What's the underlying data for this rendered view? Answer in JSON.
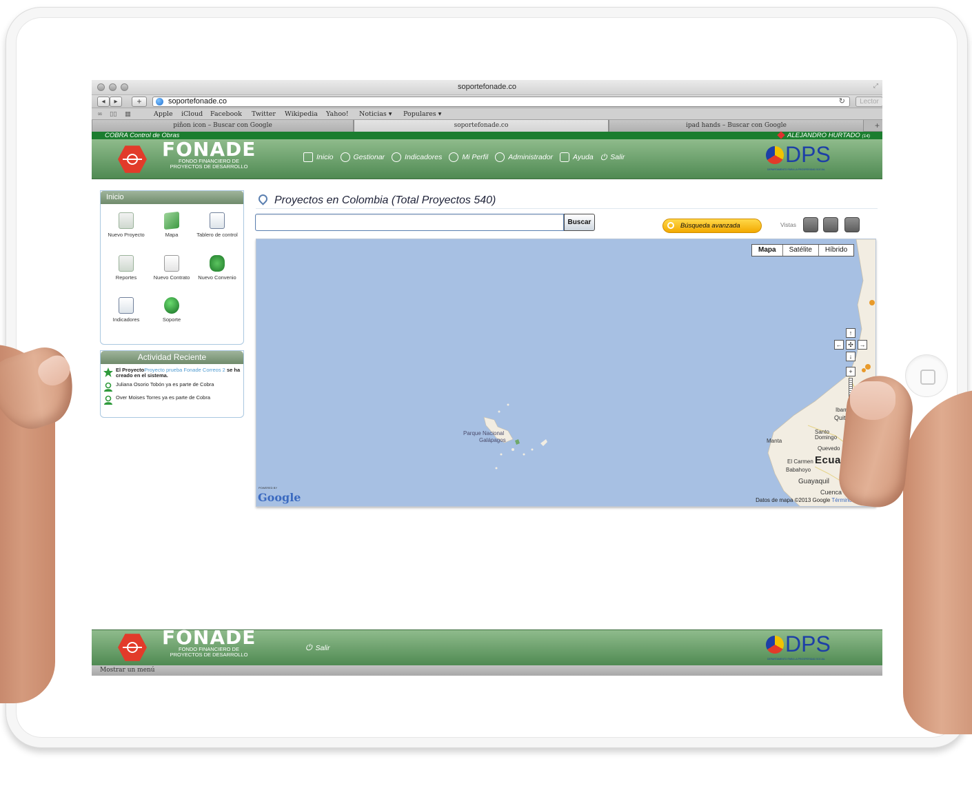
{
  "browser": {
    "window_title": "soportefonade.co",
    "address": "soportefonade.co",
    "reader_label": "Lector",
    "bookmarks": [
      "Apple",
      "iCloud",
      "Facebook",
      "Twitter",
      "Wikipedia",
      "Yahoo!",
      "Noticias ▾",
      "Populares ▾"
    ],
    "tabs": [
      {
        "label": "piñon icon – Buscar con Google",
        "active": false
      },
      {
        "label": "soportefonade.co",
        "active": true
      },
      {
        "label": "ipad hands – Buscar con Google",
        "active": false
      }
    ],
    "status_text": "Mostrar un menú"
  },
  "app": {
    "name": "COBRA Control de Obras",
    "user": "ALEJANDRO HURTADO",
    "user_suffix": "(14)",
    "logo_word": "FONADE",
    "logo_sub_1": "FONDO FINANCIERO DE",
    "logo_sub_2": "PROYECTOS DE DESARROLLO",
    "dps_text": "DPS",
    "dps_sub": "DEPARTAMENTO PARA LA PROSPERIDAD SOCIAL",
    "nav": [
      "Inicio",
      "Gestionar",
      "Indicadores",
      "Mi Perfil",
      "Administrador",
      "Ayuda",
      "Salir"
    ],
    "footer_logout": "Salir"
  },
  "sidebar": {
    "inicio_title": "Inicio",
    "quick_items": [
      {
        "label": "Nuevo Proyecto",
        "icon": "new-project-icon"
      },
      {
        "label": "Mapa",
        "icon": "map-icon"
      },
      {
        "label": "Tablero de control",
        "icon": "dashboard-icon"
      },
      {
        "label": "Reportes",
        "icon": "reports-icon"
      },
      {
        "label": "Nuevo Contrato",
        "icon": "new-contract-icon"
      },
      {
        "label": "Nuevo Convenio",
        "icon": "new-agreement-icon"
      },
      {
        "label": "Indicadores",
        "icon": "indicators-icon"
      },
      {
        "label": "Soporte",
        "icon": "support-icon"
      }
    ],
    "activity_title": "Actividad Reciente",
    "activity": {
      "item1_prefix": "El Proyecto",
      "item1_link": "Proyecto prueba Fonade Correos 2",
      "item1_suffix": "se ha creado en el sistema.",
      "item2": "Juliana Osorio Tobón ya es parte de Cobra",
      "item3": "Over Moises Torres ya es parte de Cobra"
    }
  },
  "main": {
    "title": "Proyectos en Colombia (Total Proyectos 540)",
    "search_button": "Buscar",
    "search_value": "",
    "advanced_search": "Búsqueda avanzada",
    "vistas_label": "Vistas"
  },
  "map": {
    "types": [
      "Mapa",
      "Satélite",
      "Híbrido"
    ],
    "selected_type": "Mapa",
    "powered_by": "POWERED BY",
    "google_label": "Google",
    "terms": "Datos de mapa ©2013 Google",
    "terms_link": "Términos de uso",
    "country": "Ecuador",
    "park_label_1": "Parque Nacional",
    "park_label_2": "Galápagos",
    "places": {
      "manta": "Manta",
      "santo_domingo": "Santo Domingo",
      "quevedo": "Quevedo",
      "el_carmen": "El Carmen",
      "babahoyo": "Babahoyo",
      "guayaquil": "Guayaquil",
      "cuenca": "Cuenca",
      "quito": "Quito",
      "ibarra": "Ibarr"
    },
    "colors": {
      "water": "#a7c0e3",
      "land": "#f2ede2"
    }
  },
  "colors": {
    "brand_green_top": "#1b7d2f",
    "header_green": "#6f9f6c",
    "fonade_red": "#e23b2a",
    "dps_blue": "#1d3fa6",
    "advanced_search_yellow": "#f2b400"
  }
}
